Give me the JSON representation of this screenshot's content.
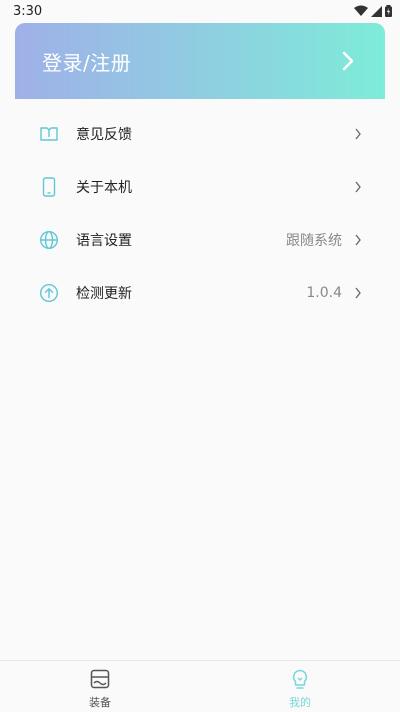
{
  "status_bar": {
    "time": "3:30"
  },
  "login": {
    "label": "登录/注册"
  },
  "menu": {
    "items": [
      {
        "label": "意见反馈",
        "value": "",
        "icon": "feedback-icon"
      },
      {
        "label": "关于本机",
        "value": "",
        "icon": "phone-icon"
      },
      {
        "label": "语言设置",
        "value": "跟随系统",
        "icon": "globe-icon"
      },
      {
        "label": "检测更新",
        "value": "1.0.4",
        "icon": "upload-arrow-icon"
      }
    ]
  },
  "tabbar": {
    "tabs": [
      {
        "label": "装备",
        "icon": "device-icon",
        "active": false
      },
      {
        "label": "我的",
        "icon": "lightbulb-icon",
        "active": true
      }
    ]
  },
  "colors": {
    "accent": "#7ad5dd",
    "gradient_start": "#9fb0e8",
    "gradient_end": "#7eecd9"
  }
}
